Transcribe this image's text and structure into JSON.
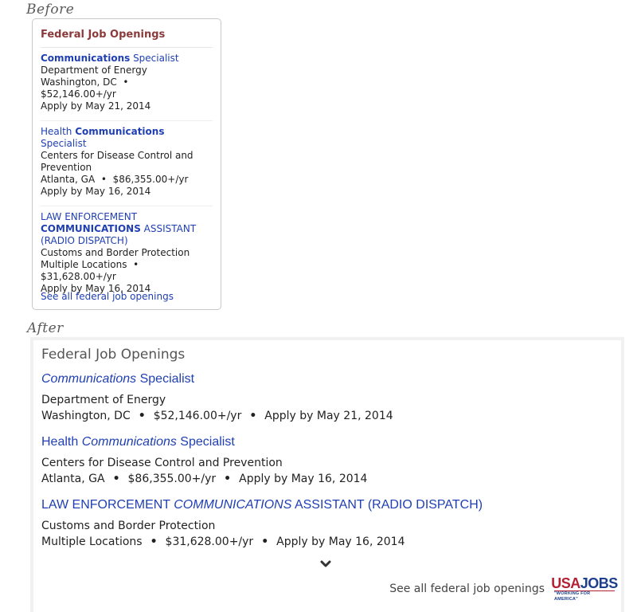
{
  "labels": {
    "before": "Before",
    "after": "After"
  },
  "before": {
    "title": "Federal Job Openings",
    "jobs": [
      {
        "title_kw": "Communications",
        "title_rest": " Specialist",
        "agency": "Department of Energy",
        "location": "Washington, DC",
        "salary": "$52,146.00+/yr",
        "apply": "Apply by May 21, 2014"
      },
      {
        "title_pre": "Health ",
        "title_kw": "Communications",
        "title_rest": " Specialist",
        "agency": "Centers for Disease Control and Prevention",
        "location": "Atlanta, GA",
        "salary": "$86,355.00+/yr",
        "apply": "Apply by May 16, 2014"
      },
      {
        "title_pre": "LAW ENFORCEMENT ",
        "title_kw": "COMMUNICATIONS",
        "title_rest": " ASSISTANT (RADIO DISPATCH)",
        "agency": "Customs and Border Protection",
        "location": "Multiple Locations",
        "salary": "$31,628.00+/yr",
        "apply": "Apply by May 16, 2014"
      }
    ],
    "see_all": "See all federal job openings"
  },
  "after": {
    "title": "Federal Job Openings",
    "jobs": [
      {
        "title_kw": "Communications",
        "title_rest": " Specialist",
        "agency": "Department of Energy",
        "location": "Washington, DC",
        "salary": "$52,146.00+/yr",
        "apply": "Apply by May 21, 2014"
      },
      {
        "title_pre": "Health ",
        "title_kw": "Communications",
        "title_rest": " Specialist",
        "agency": "Centers for Disease Control and Prevention",
        "location": "Atlanta, GA",
        "salary": "$86,355.00+/yr",
        "apply": "Apply by May 16, 2014"
      },
      {
        "title_pre": "LAW ENFORCEMENT ",
        "title_kw": "COMMUNICATIONS",
        "title_rest": " ASSISTANT (RADIO DISPATCH)",
        "agency": "Customs and Border Protection",
        "location": "Multiple Locations",
        "salary": "$31,628.00+/yr",
        "apply": "Apply by May 16, 2014"
      }
    ],
    "bullet": "•",
    "expand_icon": "chevron-down-icon",
    "see_all": "See all federal job openings",
    "logo": {
      "usa": "USA",
      "jobs": "JOBS",
      "tagline": "\"WORKING FOR AMERICA\""
    }
  },
  "colors": {
    "link": "#1f3fb3",
    "before_title": "#8a3a3a",
    "logo_red": "#b22234",
    "logo_blue": "#1c3f8e"
  }
}
